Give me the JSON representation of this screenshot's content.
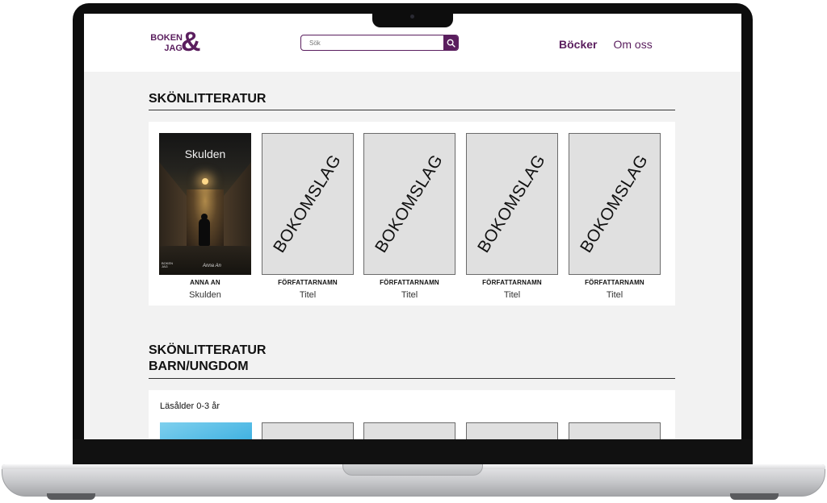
{
  "header": {
    "logo_text_1": "BOKEN",
    "logo_text_2": "JAG",
    "logo_amp": "&",
    "search_placeholder": "Sök",
    "nav": [
      {
        "label": "Böcker",
        "active": true
      },
      {
        "label": "Om oss",
        "active": false
      }
    ]
  },
  "sections": [
    {
      "title": "SKÖNLITTERATUR",
      "books": [
        {
          "author": "ANNA AN",
          "title": "Skulden",
          "cover_title": "Skulden",
          "cover_signature": "Anna An",
          "cover_logo_1": "BOKEN",
          "cover_logo_2": "JAG"
        },
        {
          "author": "FÖRFATTARNAMN",
          "title": "Titel",
          "placeholder": "BOKOMSLAG"
        },
        {
          "author": "FÖRFATTARNAMN",
          "title": "Titel",
          "placeholder": "BOKOMSLAG"
        },
        {
          "author": "FÖRFATTARNAMN",
          "title": "Titel",
          "placeholder": "BOKOMSLAG"
        },
        {
          "author": "FÖRFATTARNAMN",
          "title": "Titel",
          "placeholder": "BOKOMSLAG"
        }
      ]
    },
    {
      "title_line1": "SKÖNLITTERATUR",
      "title_line2": "BARN/UNGDOM",
      "age_group": "Läsålder 0-3 år"
    }
  ],
  "colors": {
    "brand": "#5a1e5e",
    "background": "#f2f2f2",
    "placeholder_cover": "#e0e0e0"
  }
}
